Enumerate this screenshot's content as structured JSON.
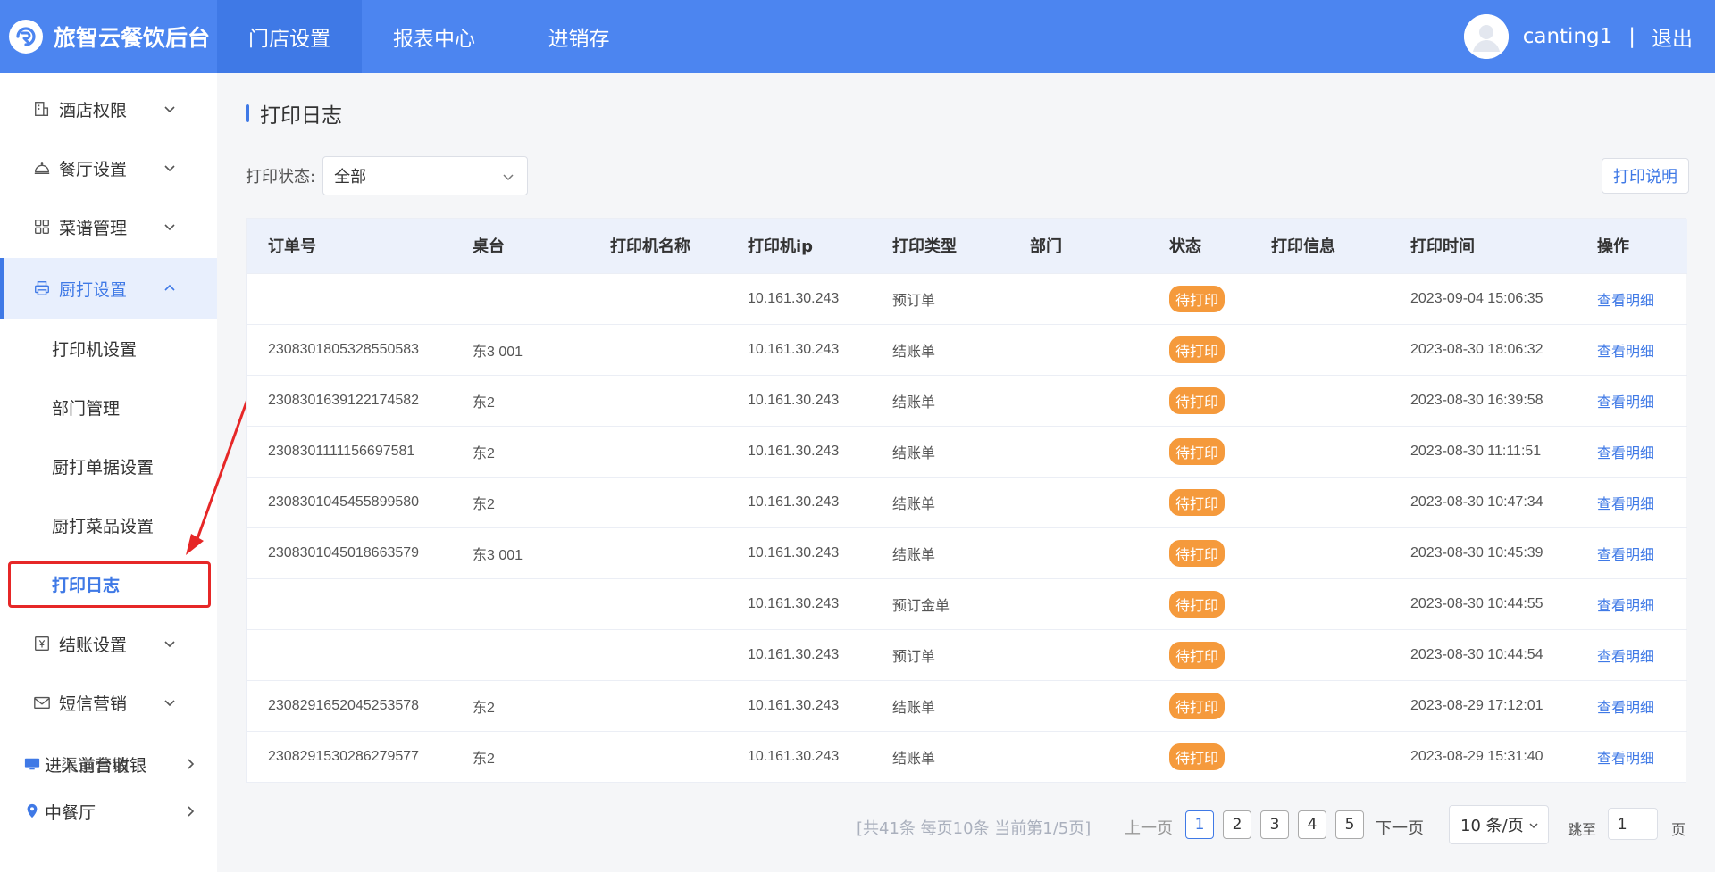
{
  "brand": {
    "name": "旅智云餐饮后台",
    "logo_icon": "brand-logo-icon"
  },
  "nav": {
    "items": [
      {
        "label": "门店设置",
        "active": true
      },
      {
        "label": "报表中心",
        "active": false
      },
      {
        "label": "进销存",
        "active": false
      }
    ]
  },
  "user": {
    "name": "canting1",
    "separator": "|",
    "logout": "退出"
  },
  "sidebar": {
    "menu": [
      {
        "label": "酒店权限",
        "icon": "hotel-icon"
      },
      {
        "label": "餐厅设置",
        "icon": "cloche-icon"
      },
      {
        "label": "菜谱管理",
        "icon": "grid-icon"
      },
      {
        "label": "厨打设置",
        "icon": "printer-icon"
      },
      {
        "label": "结账设置",
        "icon": "yen-box-icon"
      },
      {
        "label": "短信营销",
        "icon": "mail-icon"
      }
    ],
    "submenu": [
      {
        "label": "打印机设置"
      },
      {
        "label": "部门管理"
      },
      {
        "label": "厨打单据设置"
      },
      {
        "label": "厨打菜品设置"
      },
      {
        "label": "打印日志",
        "active": true
      }
    ],
    "extra": [
      {
        "label": "进入前台收银",
        "label_overlap": "渠道营销",
        "icon": "monitor-icon"
      },
      {
        "label": "中餐厅",
        "icon": "location-pin-icon"
      }
    ]
  },
  "page": {
    "title": "打印日志",
    "filter_label": "打印状态:",
    "filter_value": "全部",
    "explain_button": "打印说明"
  },
  "table": {
    "columns": [
      "订单号",
      "桌台",
      "打印机名称",
      "打印机ip",
      "打印类型",
      "部门",
      "状态",
      "打印信息",
      "打印时间",
      "操作"
    ],
    "rows": [
      {
        "order": "",
        "table": "",
        "printer": "",
        "ip": "10.161.30.243",
        "type": "预订单",
        "dept": "",
        "status": "待打印",
        "info": "",
        "time": "2023-09-04 15:06:35",
        "action": "查看明细"
      },
      {
        "order": "2308301805328550583",
        "table": "东3 001",
        "printer": "",
        "ip": "10.161.30.243",
        "type": "结账单",
        "dept": "",
        "status": "待打印",
        "info": "",
        "time": "2023-08-30 18:06:32",
        "action": "查看明细"
      },
      {
        "order": "2308301639122174582",
        "table": "东2",
        "printer": "",
        "ip": "10.161.30.243",
        "type": "结账单",
        "dept": "",
        "status": "待打印",
        "info": "",
        "time": "2023-08-30 16:39:58",
        "action": "查看明细"
      },
      {
        "order": "2308301111156697581",
        "table": "东2",
        "printer": "",
        "ip": "10.161.30.243",
        "type": "结账单",
        "dept": "",
        "status": "待打印",
        "info": "",
        "time": "2023-08-30 11:11:51",
        "action": "查看明细"
      },
      {
        "order": "2308301045455899580",
        "table": "东2",
        "printer": "",
        "ip": "10.161.30.243",
        "type": "结账单",
        "dept": "",
        "status": "待打印",
        "info": "",
        "time": "2023-08-30 10:47:34",
        "action": "查看明细"
      },
      {
        "order": "2308301045018663579",
        "table": "东3 001",
        "printer": "",
        "ip": "10.161.30.243",
        "type": "结账单",
        "dept": "",
        "status": "待打印",
        "info": "",
        "time": "2023-08-30 10:45:39",
        "action": "查看明细"
      },
      {
        "order": "",
        "table": "",
        "printer": "",
        "ip": "10.161.30.243",
        "type": "预订金单",
        "dept": "",
        "status": "待打印",
        "info": "",
        "time": "2023-08-30 10:44:55",
        "action": "查看明细"
      },
      {
        "order": "",
        "table": "",
        "printer": "",
        "ip": "10.161.30.243",
        "type": "预订单",
        "dept": "",
        "status": "待打印",
        "info": "",
        "time": "2023-08-30 10:44:54",
        "action": "查看明细"
      },
      {
        "order": "2308291652045253578",
        "table": "东2",
        "printer": "",
        "ip": "10.161.30.243",
        "type": "结账单",
        "dept": "",
        "status": "待打印",
        "info": "",
        "time": "2023-08-29 17:12:01",
        "action": "查看明细"
      },
      {
        "order": "2308291530286279577",
        "table": "东2",
        "printer": "",
        "ip": "10.161.30.243",
        "type": "结账单",
        "dept": "",
        "status": "待打印",
        "info": "",
        "time": "2023-08-29 15:31:40",
        "action": "查看明细"
      }
    ]
  },
  "pagination": {
    "info": "[共41条 每页10条 当前第1/5页]",
    "prev": "上一页",
    "next": "下一页",
    "pages": [
      "1",
      "2",
      "3",
      "4",
      "5"
    ],
    "current": "1",
    "page_size": "10 条/页",
    "jump_label": "跳至",
    "jump_value": "1",
    "page_suffix": "页"
  },
  "colors": {
    "primary": "#4c85f0",
    "active_nav": "#3f79e6",
    "badge": "#f59a3c",
    "annotation": "#e62727"
  }
}
